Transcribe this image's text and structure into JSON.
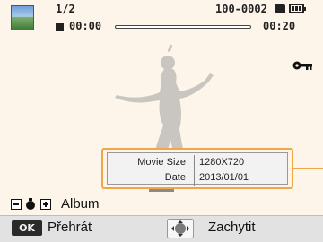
{
  "status": {
    "counter": "1/2",
    "elapsed": "00:00",
    "file_number": "100-0002",
    "total": "00:20",
    "progress": 0
  },
  "info_box": {
    "rows": [
      {
        "label": "Movie Size",
        "value": "1280X720"
      },
      {
        "label": "Date",
        "value": "2013/01/01"
      }
    ]
  },
  "album": {
    "label": "Album"
  },
  "footer": {
    "ok_key": "OK",
    "play_label": "Přehrát",
    "capture_label": "Zachytit"
  },
  "icons": {
    "thumbnail": "thumbnail-icon",
    "stop": "stop-icon",
    "memory_card": "memory-card-icon",
    "battery": "battery-icon",
    "protect": "key-icon",
    "album_dial": "album-dial-icon",
    "navigation": "navigation-button-icon"
  },
  "colors": {
    "background": "#fdf5e9",
    "accent": "#f0a74c",
    "bottom_bar": "#e2e2e2"
  }
}
